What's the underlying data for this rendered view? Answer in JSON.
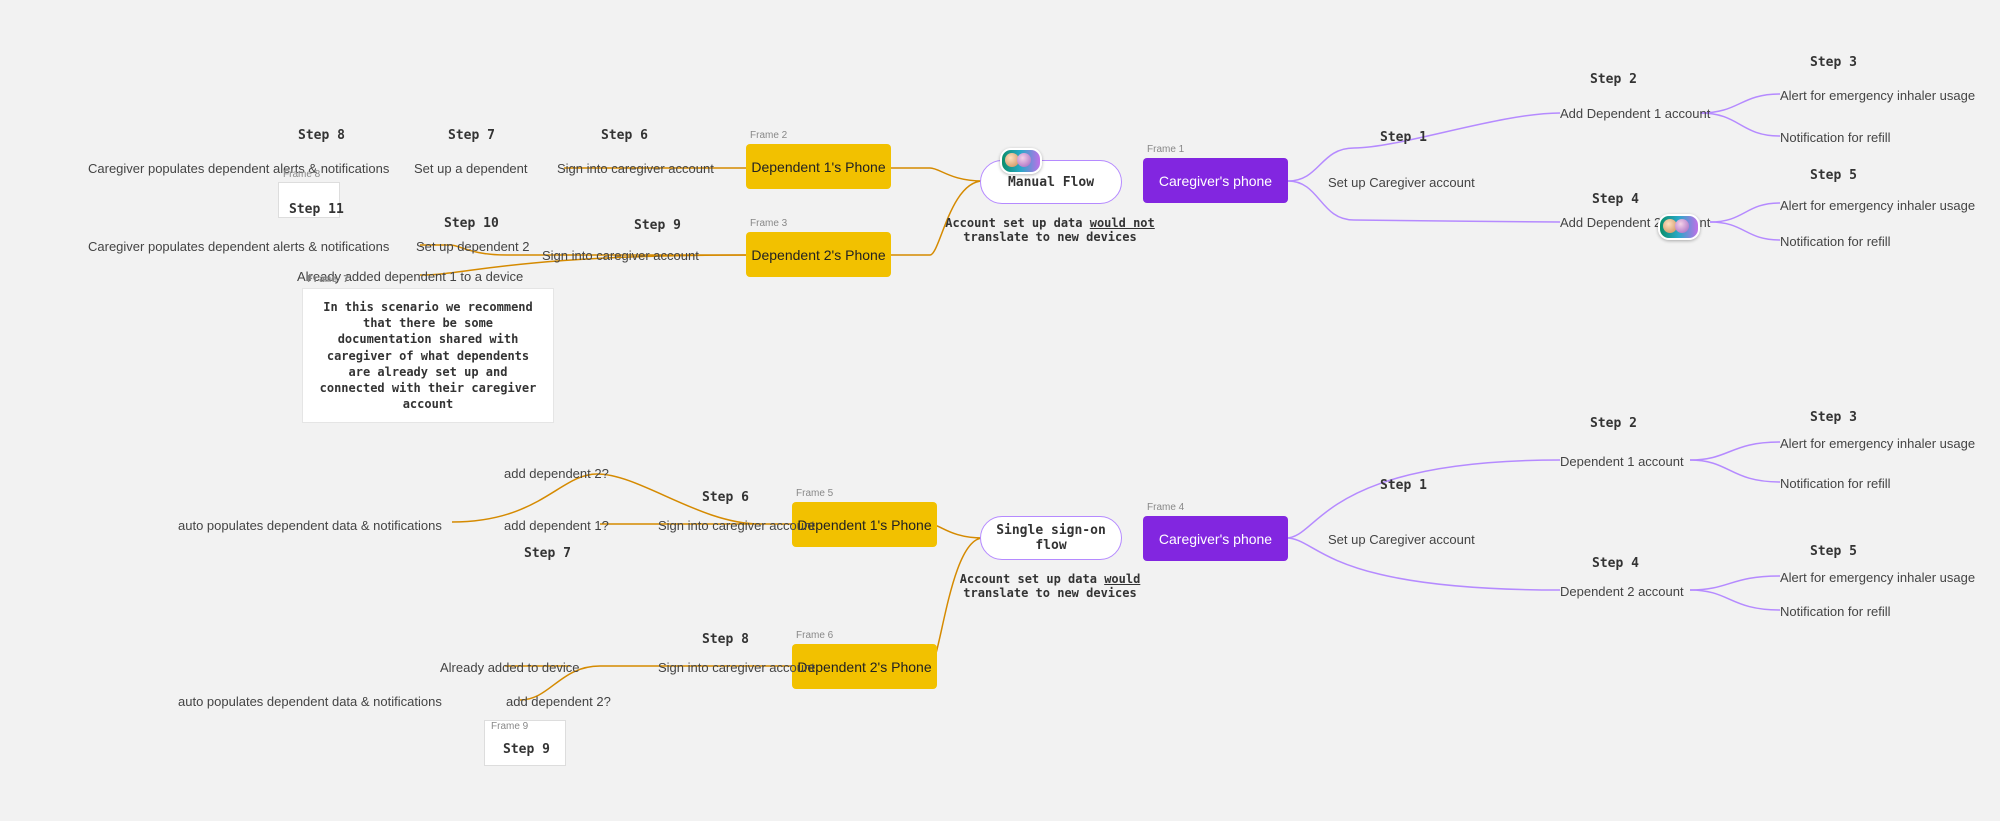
{
  "flows": {
    "manual": {
      "title": "Manual Flow",
      "caption_pre": "Account set up data ",
      "caption_em": "would not",
      "caption_post": " translate to new devices"
    },
    "sso": {
      "title": "Single sign-on flow",
      "caption_pre": "Account set up data ",
      "caption_em": "would",
      "caption_post": " translate to new devices"
    }
  },
  "frames": {
    "f1": {
      "label": "Frame 1",
      "text": "Caregiver's phone"
    },
    "f2": {
      "label": "Frame 2",
      "text": "Dependent 1's Phone"
    },
    "f3": {
      "label": "Frame 3",
      "text": "Dependent 2's Phone"
    },
    "f4": {
      "label": "Frame 4",
      "text": "Caregiver's phone"
    },
    "f5": {
      "label": "Frame 5",
      "text": "Dependent 1's Phone"
    },
    "f6": {
      "label": "Frame 6",
      "text": "Dependent 2's Phone"
    },
    "f7": {
      "label": "Frame 7"
    },
    "f8": {
      "label": "Frame 8"
    },
    "f9": {
      "label": "Frame 9"
    }
  },
  "steps": {
    "s1": "Step 1",
    "s2": "Step 2",
    "s3": "Step 3",
    "s4": "Step 4",
    "s5": "Step 5",
    "s6": "Step 6",
    "s7": "Step 7",
    "s8": "Step 8",
    "s9": "Step 9",
    "s10": "Step 10",
    "s11": "Step 11"
  },
  "labels": {
    "setup_caregiver": "Set up Caregiver account",
    "add_dep1": "Add Dependent 1 account",
    "add_dep2": "Add Dependent 2 account",
    "dep1_acct": "Dependent 1 account",
    "dep2_acct": "Dependent 2 account",
    "alert_emergency": "Alert for emergency inhaler usage",
    "notify_refill": "Notification for refill",
    "signin_caregiver": "Sign into caregiver account",
    "set_up_dependent": "Set up a dependent",
    "set_up_dep2": "Set up dependent  2",
    "already_added_dep1": "Already added dependent 1 to a device",
    "caregiver_populates_alerts": "Caregiver populates dependent alerts  & notifications",
    "caregiver_populates_alerts2": "Caregiver populates dependent alerts & notifications",
    "add_dep1_q": "add dependent 1?",
    "add_dep2_q": "add dependent 2?",
    "add_dep2_q_spaced": "add dependent  2?",
    "auto_populates": "auto populates dependent data  & notifications",
    "auto_populates2": "auto populates dependent data & notifications",
    "already_added_device": "Already added to device",
    "note": "In this scenario we recommend that there be some documentation shared with caregiver of what dependents are already set up and connected with their caregiver account"
  },
  "colors": {
    "orange": "#d58a00",
    "purple": "#b58aff"
  }
}
